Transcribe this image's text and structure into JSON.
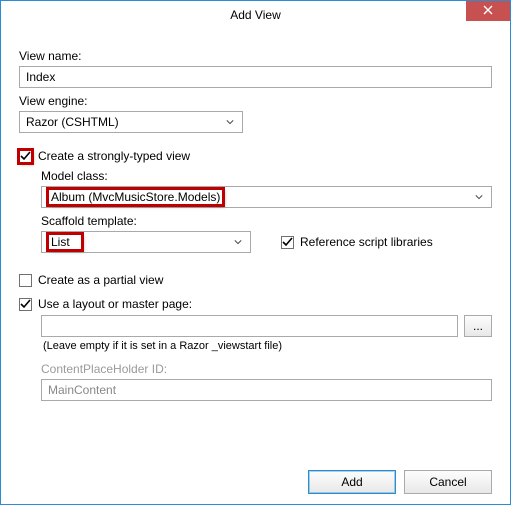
{
  "window": {
    "title": "Add View"
  },
  "fields": {
    "viewNameLabel": "View name:",
    "viewNameValue": "Index",
    "viewEngineLabel": "View engine:",
    "viewEngineValue": "Razor (CSHTML)",
    "stronglyTypedLabel": "Create a strongly-typed view",
    "modelClassLabel": "Model class:",
    "modelClassValue": "Album (MvcMusicStore.Models)",
    "scaffoldLabel": "Scaffold template:",
    "scaffoldValue": "List",
    "referenceScriptsLabel": "Reference script libraries",
    "partialViewLabel": "Create as a partial view",
    "useLayoutLabel": "Use a layout or master page:",
    "layoutValue": "",
    "layoutHint": "(Leave empty if it is set in a Razor _viewstart file)",
    "cphLabel": "ContentPlaceHolder ID:",
    "cphValue": "MainContent",
    "browseLabel": "..."
  },
  "buttons": {
    "add": "Add",
    "cancel": "Cancel"
  },
  "checks": {
    "stronglyTyped": true,
    "referenceScripts": true,
    "partialView": false,
    "useLayout": true
  }
}
